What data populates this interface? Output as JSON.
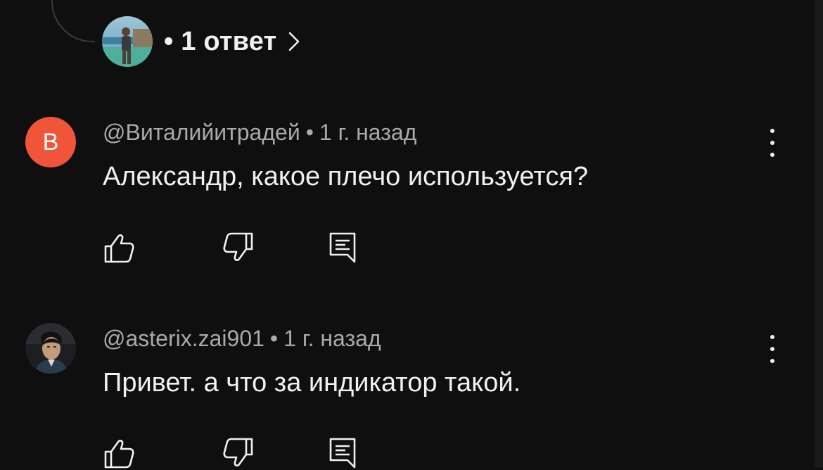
{
  "replies": {
    "count_label": "• 1 ответ",
    "chevron_icon": "chevron-right-icon"
  },
  "comments": [
    {
      "author": "@Виталийитрадей",
      "separator": "•",
      "time": "1 г. назад",
      "text": "Александр, какое плечо используется?",
      "avatar_letter": "В",
      "avatar_color": "#f0553a",
      "icons": [
        "like-icon",
        "dislike-icon",
        "reply-icon",
        "more-vert-icon"
      ]
    },
    {
      "author": "@asterix.zai901",
      "separator": "•",
      "time": "1 г. назад",
      "text": "Привет. а что за индикатор такой.",
      "avatar_type": "photo",
      "icons": [
        "like-icon",
        "dislike-icon",
        "reply-icon",
        "more-vert-icon"
      ]
    }
  ],
  "colors": {
    "background": "#0f0f0f",
    "text_primary": "#f1f1f1",
    "text_secondary": "#aaaaaa",
    "avatar_orange": "#f0553a"
  }
}
